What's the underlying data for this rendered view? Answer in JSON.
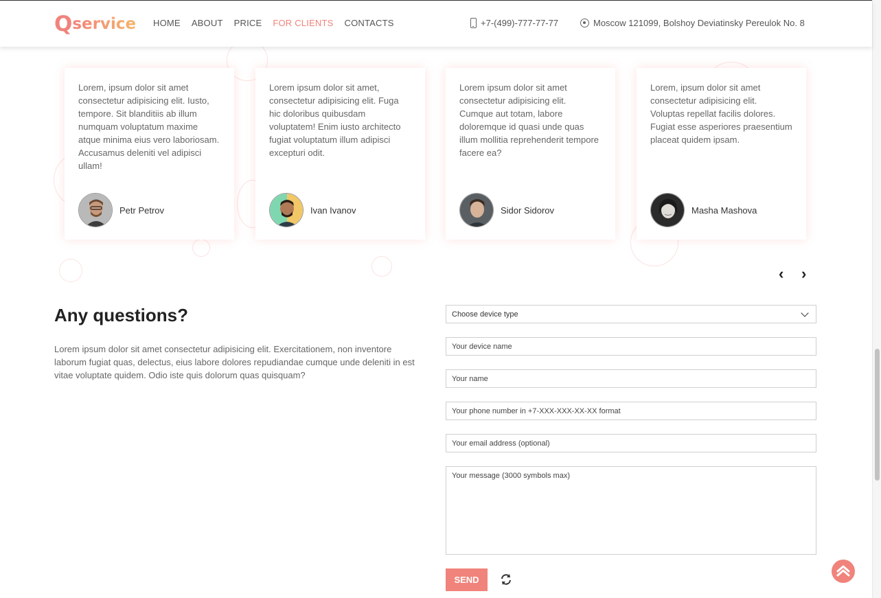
{
  "header": {
    "logo_q": "Q",
    "logo_text": "service",
    "nav": [
      {
        "label": "HOME",
        "active": false
      },
      {
        "label": "ABOUT",
        "active": false
      },
      {
        "label": "PRICE",
        "active": false
      },
      {
        "label": "FOR CLIENTS",
        "active": true
      },
      {
        "label": "CONTACTS",
        "active": false
      }
    ],
    "phone": "+7-(499)-777-77-77",
    "address": "Moscow 121099, Bolshoy Deviatinsky Pereulok No. 8"
  },
  "reviews": [
    {
      "text": "Lorem, ipsum dolor sit amet consectetur adipisicing elit. Iusto, tempore. Sit blanditiis ab illum numquam voluptatum maxime atque minima eius vero laboriosam. Accusamus deleniti vel adipisci ullam!",
      "name": "Petr Petrov"
    },
    {
      "text": "Lorem ipsum dolor sit amet, consectetur adipisicing elit. Fuga hic doloribus quibusdam voluptatem! Enim iusto architecto fugiat voluptatum illum adipisci excepturi odit.",
      "name": "Ivan Ivanov"
    },
    {
      "text": "Lorem ipsum dolor sit amet consectetur adipisicing elit. Cumque aut totam, labore doloremque id quasi unde quas illum mollitia reprehenderit tempore facere ea?",
      "name": "Sidor Sidorov"
    },
    {
      "text": "Lorem, ipsum dolor sit amet consectetur adipisicing elit. Voluptas repellat facilis dolores. Fugiat esse asperiores praesentium placeat quidem ipsam.",
      "name": "Masha Mashova"
    }
  ],
  "slider": {
    "prev": "‹",
    "next": "›"
  },
  "questions": {
    "title": "Any questions?",
    "text": "Lorem ipsum dolor sit amet consectetur adipisicing elit. Exercitationem, non inventore laborum fugiat quas, delectus, eius labore dolores repudiandae cumque unde deleniti in est vitae voluptate quidem. Odio iste quis dolorum quas quisquam?"
  },
  "form": {
    "device_type": "Choose device type",
    "device_name_placeholder": "Your device name",
    "name_placeholder": "Your name",
    "phone_placeholder": "Your phone number in +7-XXX-XXX-XX-XX format",
    "email_placeholder": "Your email address (optional)",
    "message_placeholder": "Your message (3000 symbols max)",
    "send_label": "SEND"
  },
  "colors": {
    "accent": "#f0837b",
    "accent2": "#f6b56b"
  },
  "icons": [
    "phone-icon",
    "location-icon",
    "chevron-down-icon",
    "refresh-icon",
    "scroll-to-top-icon"
  ]
}
